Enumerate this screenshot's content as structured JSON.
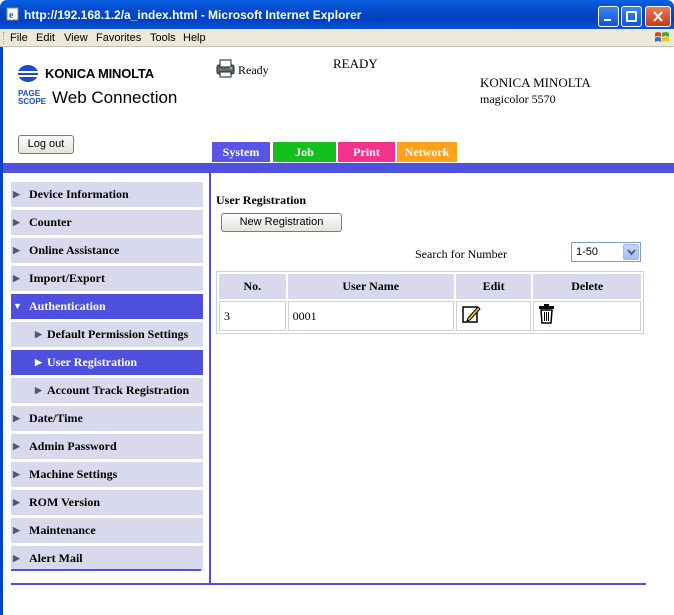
{
  "window": {
    "title": "http://192.168.1.2/a_index.html - Microsoft Internet Explorer"
  },
  "menu": [
    "File",
    "Edit",
    "View",
    "Favorites",
    "Tools",
    "Help"
  ],
  "header": {
    "brand_logo": "KONICA MINOLTA",
    "pagescope_mark": [
      "PAGE",
      "SCOPE"
    ],
    "pagescope_text": "Web Connection",
    "status_small": "Ready",
    "status_big": "READY",
    "device_brand": "KONICA MINOLTA",
    "device_model": "magicolor 5570",
    "logout_label": "Log out"
  },
  "tabs": [
    {
      "label": "System",
      "color": "#5a55e6"
    },
    {
      "label": "Job",
      "color": "#13c01e"
    },
    {
      "label": "Print",
      "color": "#f4328c"
    },
    {
      "label": "Network",
      "color": "#ffa219"
    }
  ],
  "sidebar": {
    "items": [
      {
        "label": "Device Information"
      },
      {
        "label": "Counter"
      },
      {
        "label": "Online Assistance"
      },
      {
        "label": "Import/Export"
      },
      {
        "label": "Authentication",
        "active": true,
        "expanded": true
      },
      {
        "label": "Default Permission Settings"
      },
      {
        "label": "User Registration",
        "active": true
      },
      {
        "label": "Account Track Registration"
      },
      {
        "label": "Date/Time"
      },
      {
        "label": "Admin Password"
      },
      {
        "label": "Machine Settings"
      },
      {
        "label": "ROM Version"
      },
      {
        "label": "Maintenance"
      },
      {
        "label": "Alert Mail"
      }
    ]
  },
  "main": {
    "section_title": "User Registration",
    "new_registration_label": "New Registration",
    "search_label": "Search for Number",
    "range_selected": "1-50",
    "table": {
      "headers": [
        "No.",
        "User Name",
        "Edit",
        "Delete"
      ],
      "rows": [
        {
          "no": "3",
          "user_name": "0001"
        }
      ]
    }
  },
  "colors": {
    "accent": "#5050df",
    "nav_bg": "#d9d9ee"
  }
}
